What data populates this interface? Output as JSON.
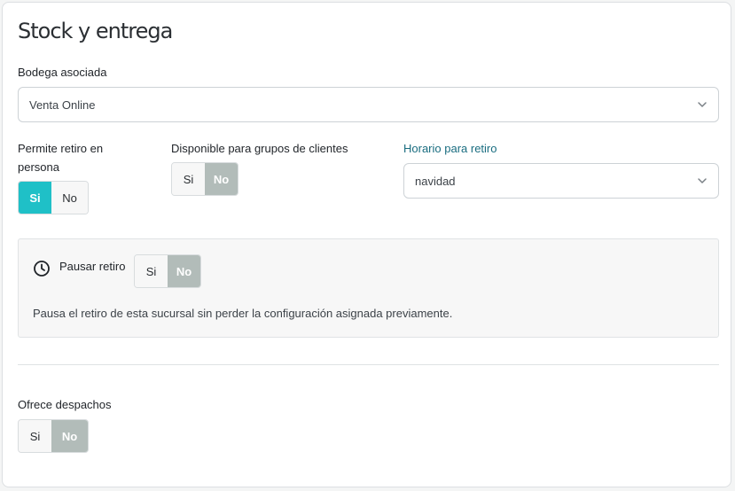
{
  "title": "Stock y entrega",
  "warehouse": {
    "label": "Bodega asociada",
    "value": "Venta Online",
    "chevron_icon": "chevron-down-icon"
  },
  "pickup": {
    "label": "Permite retiro en persona",
    "option_yes": "Si",
    "option_no": "No",
    "selected": "Si"
  },
  "customer_groups": {
    "label": "Disponible para grupos de clientes",
    "option_yes": "Si",
    "option_no": "No",
    "selected": "No"
  },
  "schedule": {
    "label": "Horario para retiro",
    "value": "navidad",
    "chevron_icon": "chevron-down-icon"
  },
  "pause": {
    "icon": "clock-icon",
    "label": "Pausar retiro",
    "option_yes": "Si",
    "option_no": "No",
    "selected": "No",
    "description": "Pausa el retiro de esta sucursal sin perder la configuración asignada previamente."
  },
  "shipping": {
    "label": "Ofrece despachos",
    "option_yes": "Si",
    "option_no": "No",
    "selected": "No"
  },
  "colors": {
    "accent_teal": "#1fc0c7",
    "selected_gray": "#b2bcb9",
    "link_teal": "#1a6d80"
  }
}
